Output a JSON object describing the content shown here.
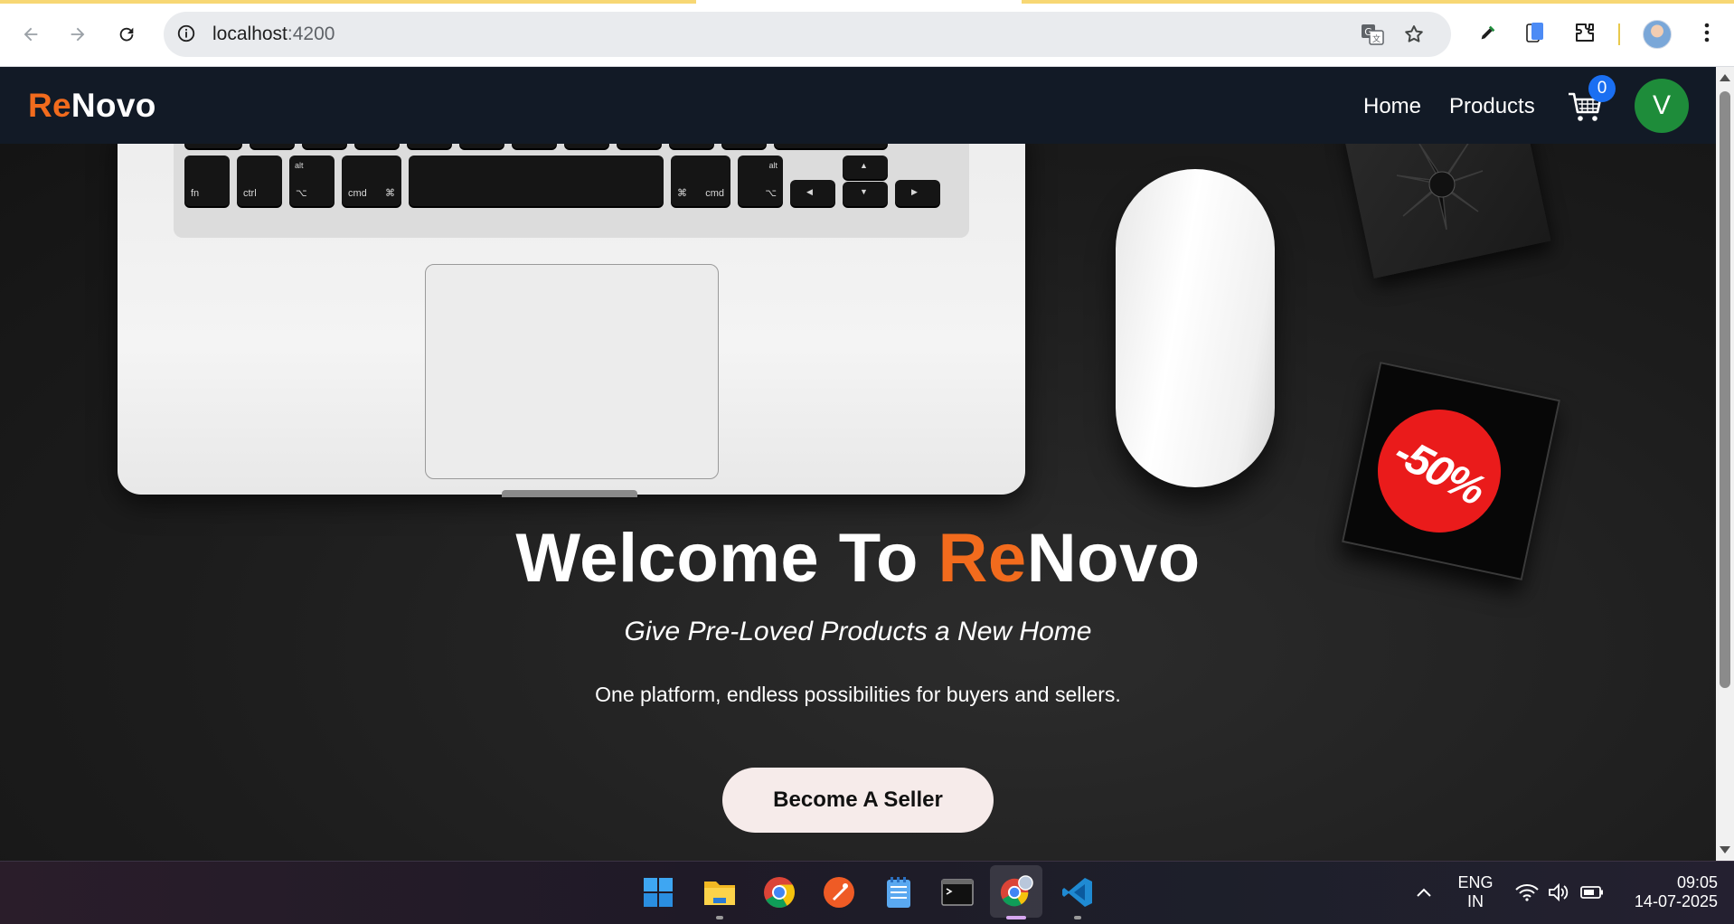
{
  "browser": {
    "url_host": "localhost",
    "url_port": ":4200",
    "back_icon": "arrow-left-icon",
    "forward_icon": "arrow-right-icon",
    "reload_icon": "reload-icon"
  },
  "navbar": {
    "logo_re": "Re",
    "logo_novo": "Novo",
    "links": [
      "Home",
      "Products"
    ],
    "cart_count": "0",
    "avatar_initial": "V"
  },
  "hero": {
    "title_prefix": "Welcome To ",
    "title_re": "Re",
    "title_novo": "Novo",
    "subtitle": "Give Pre-Loved Products a New Home",
    "description": "One platform, endless possibilities for buyers and sellers.",
    "cta": "Become A Seller",
    "sale_sticker": "-50%"
  },
  "laptop_keys": {
    "fn": "fn",
    "ctrl": "ctrl",
    "alt": "alt",
    "opt": "⌥",
    "cmd": "cmd",
    "cmd_symbol": "⌘",
    "shift": "⇧",
    "left": "◀",
    "right": "▶",
    "up": "▲",
    "down": "▼",
    "comma": ",",
    "period": ".",
    "slash": "/"
  },
  "taskbar": {
    "language_top": "ENG",
    "language_bottom": "IN",
    "time": "09:05",
    "date": "14-07-2025"
  },
  "colors": {
    "brand_orange": "#f26b1d",
    "navbar_bg": "#121a26",
    "avatar_green": "#1e8c3a",
    "badge_blue": "#1a6ff2",
    "cta_bg": "#f6ebea"
  }
}
